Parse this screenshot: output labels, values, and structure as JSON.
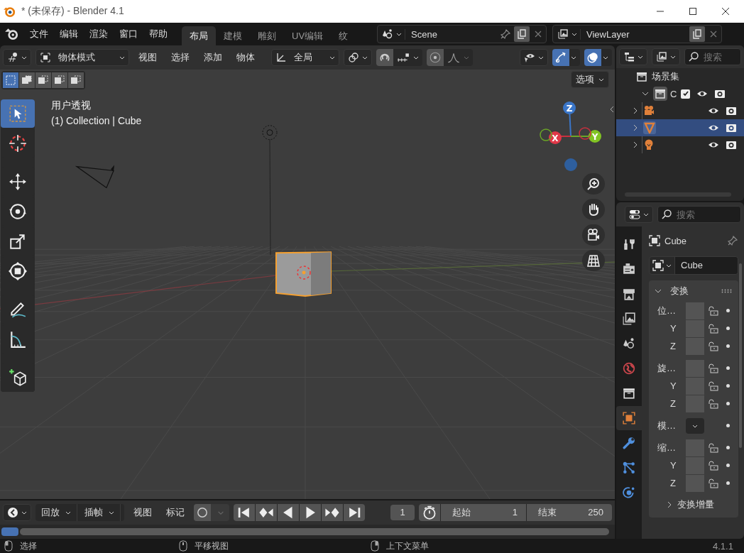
{
  "window": {
    "title": "* (未保存) - Blender 4.1"
  },
  "menu": [
    "文件",
    "编辑",
    "渲染",
    "窗口",
    "帮助"
  ],
  "workspaces": [
    {
      "label": "布局",
      "selected": true
    },
    {
      "label": "建模",
      "selected": false
    },
    {
      "label": "雕刻",
      "selected": false
    },
    {
      "label": "UV编辑",
      "selected": false
    },
    {
      "label": "纹",
      "selected": false
    }
  ],
  "scene": {
    "name": "Scene"
  },
  "view_layer": {
    "name": "ViewLayer"
  },
  "viewport_header": {
    "mode": "物体模式",
    "menus": [
      "视图",
      "选择",
      "添加",
      "物体"
    ],
    "orientation": "全局",
    "snap_on": false,
    "gizmos_on": true,
    "overlays_on": true
  },
  "select_modes": [
    {
      "selected": true
    },
    {
      "selected": false
    },
    {
      "selected": false
    },
    {
      "selected": false
    },
    {
      "selected": false
    }
  ],
  "viewport": {
    "view_name": "用户透视",
    "context": "(1) Collection | Cube",
    "options": "选项",
    "axes": [
      "X",
      "Y",
      "Z"
    ]
  },
  "tools": [
    {
      "kind": "select",
      "selected": true
    },
    {
      "kind": "cursor",
      "selected": false
    },
    {
      "kind": "move",
      "selected": false
    },
    {
      "kind": "rotate",
      "selected": false
    },
    {
      "kind": "scale",
      "selected": false
    },
    {
      "kind": "transform",
      "selected": false
    },
    {
      "kind": "annotate",
      "selected": false
    },
    {
      "kind": "measure",
      "selected": false
    },
    {
      "kind": "add_cube",
      "selected": false
    }
  ],
  "outliner": {
    "search_placeholder": "搜索",
    "root": "场景集",
    "collection": {
      "name": "C",
      "checked": true,
      "expanded": true,
      "children": [
        {
          "kind": "camera",
          "selected": false
        },
        {
          "kind": "mesh",
          "selected": true
        },
        {
          "kind": "light",
          "selected": false
        }
      ]
    }
  },
  "properties": {
    "search_placeholder": "搜索",
    "tabs": [
      {
        "kind": "tool",
        "selected": false
      },
      {
        "kind": "render",
        "selected": false
      },
      {
        "kind": "output",
        "selected": false
      },
      {
        "kind": "view_layer",
        "selected": false
      },
      {
        "kind": "scene",
        "selected": false
      },
      {
        "kind": "world",
        "selected": false
      },
      {
        "kind": "collection",
        "selected": false
      },
      {
        "kind": "object",
        "selected": true
      },
      {
        "kind": "modifier",
        "selected": false
      },
      {
        "kind": "particles",
        "selected": false
      },
      {
        "kind": "physics",
        "selected": false
      }
    ],
    "object_name": "Cube",
    "data_name": "Cube",
    "panel": {
      "title": "变换",
      "expanded": true,
      "rows": [
        {
          "label": "位…",
          "kind": "field",
          "sub": false
        },
        {
          "label": "Y",
          "kind": "field",
          "sub": true
        },
        {
          "label": "Z",
          "kind": "field",
          "sub": true
        },
        {
          "label": "旋…",
          "kind": "field",
          "sub": false
        },
        {
          "label": "Y",
          "kind": "field",
          "sub": true
        },
        {
          "label": "Z",
          "kind": "field",
          "sub": true
        },
        {
          "label": "模…",
          "kind": "dropdown",
          "sub": false
        },
        {
          "label": "缩…",
          "kind": "field",
          "sub": false
        },
        {
          "label": "Y",
          "kind": "field",
          "sub": true
        },
        {
          "label": "Z",
          "kind": "field",
          "sub": true
        }
      ]
    },
    "subpanel": {
      "title": "变换增量",
      "expanded": false
    }
  },
  "timeline": {
    "menus": [
      "回放",
      "插帧"
    ],
    "items": [
      "视图",
      "标记"
    ],
    "current_frame": "1",
    "start_label": "起始",
    "start": "1",
    "end_label": "结束",
    "end": "250"
  },
  "status_bar": {
    "items": [
      {
        "kind": "left_mouse",
        "label": "选择"
      },
      {
        "kind": "middle_mouse",
        "label": "平移视图"
      },
      {
        "kind": "right_mouse",
        "label": "上下文菜单"
      }
    ],
    "version": "4.1.1"
  }
}
